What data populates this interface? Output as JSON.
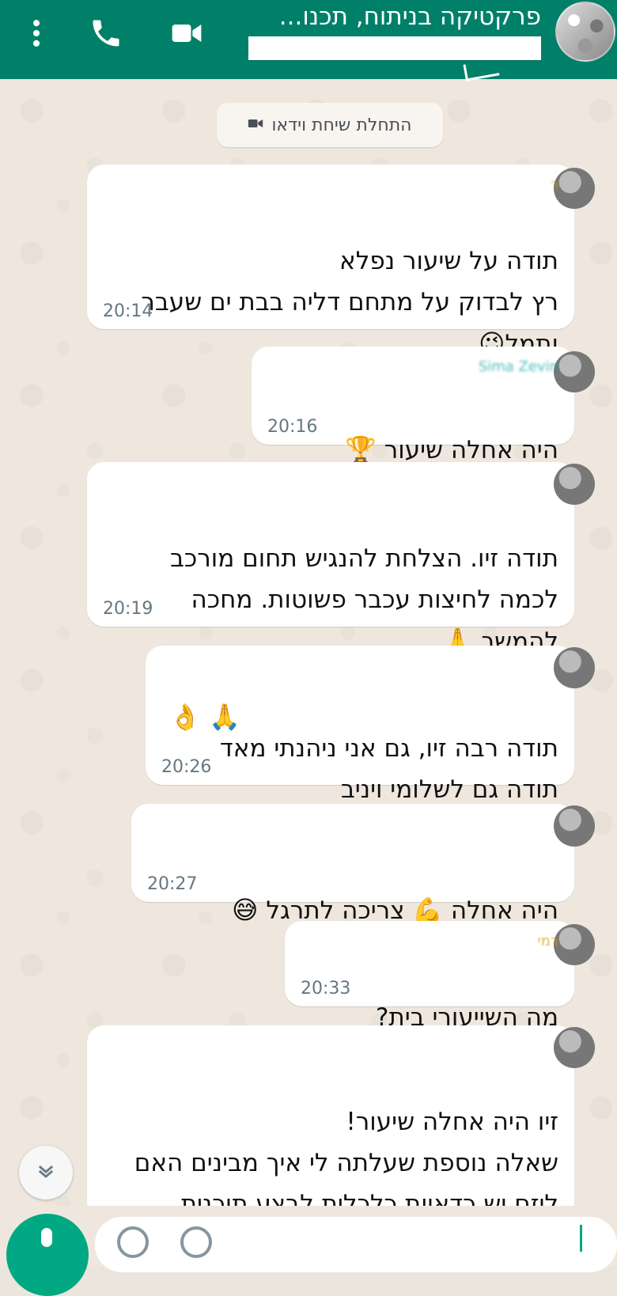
{
  "header": {
    "title": "פרקטיקה בניתוח, תכנו..."
  },
  "system_message": "התחלת שיחת וידאו",
  "messages": [
    {
      "sender": "ר",
      "text": "תודה על שיעור נפלא\nרץ לבדוק על מתחם דליה בבת ים שעבר\nותמל",
      "emoji": "😉",
      "time": "20:14"
    },
    {
      "sender": "Sima Zevin",
      "text": "היה אחלה שיעור",
      "emoji": "🏆",
      "time": "20:16"
    },
    {
      "sender": "",
      "text": "תודה זיו. הצלחת להנגיש תחום מורכב\nלכמה לחיצות עכבר פשוטות. מחכה\nלהמשך",
      "emoji": "🙏",
      "time": "20:19"
    },
    {
      "sender": "",
      "text": "תודה רבה זיו, גם אני ניהנתי מאד\nתודה גם לשלומי ויניב",
      "emoji": "👌 🙏",
      "time": "20:26"
    },
    {
      "sender": "",
      "text": "היה אחלה 💪 צריכה לתרגל",
      "emoji": "😅",
      "time": "20:27"
    },
    {
      "sender": "רמי",
      "text": "מה השייעורי בית?",
      "emoji": "",
      "time": "20:33"
    },
    {
      "sender": "",
      "text": "זיו היה אחלה שיעור!\nשאלה נוספת שעלתה לי איך מבינים האם\nליזם יש כדאיות כלכלית לבצע תוכנית\nשאושרה?",
      "emoji": "",
      "time": ""
    }
  ],
  "icons": {
    "video": "video-call-icon",
    "call": "phone-call-icon",
    "more": "more-options-icon",
    "scroll": "scroll-down-icon",
    "system": "video-camera-icon"
  },
  "colors": {
    "header": "#008069",
    "accent": "#00a884",
    "chat_bg": "#efe7de",
    "bubble": "#ffffff",
    "time": "#667781"
  }
}
